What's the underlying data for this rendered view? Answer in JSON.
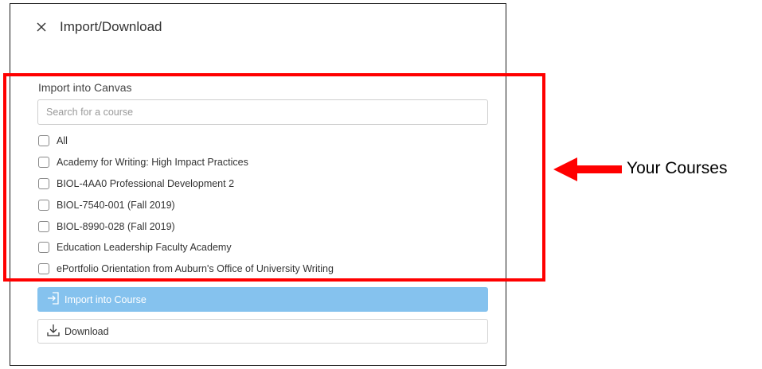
{
  "dialog": {
    "title": "Import/Download",
    "close_icon": "close-icon"
  },
  "import_section": {
    "label": "Import into Canvas",
    "search_placeholder": "Search for a course",
    "search_value": "",
    "courses": [
      {
        "label": "All",
        "checked": false
      },
      {
        "label": "Academy for Writing: High Impact Practices",
        "checked": false
      },
      {
        "label": "BIOL-4AA0 Professional Development 2",
        "checked": false
      },
      {
        "label": "BIOL-7540-001 (Fall 2019)",
        "checked": false
      },
      {
        "label": "BIOL-8990-028 (Fall 2019)",
        "checked": false
      },
      {
        "label": "Education Leadership Faculty Academy",
        "checked": false
      },
      {
        "label": "ePortfolio Orientation from Auburn's Office of University Writing",
        "checked": false
      }
    ]
  },
  "actions": {
    "import_label": "Import into Course",
    "import_icon": "import-icon",
    "download_label": "Download",
    "download_icon": "download-icon"
  },
  "annotation": {
    "label": "Your Courses",
    "color": "#ff0000"
  },
  "colors": {
    "primary_button": "#85c2ee",
    "highlight": "#ff0000"
  }
}
